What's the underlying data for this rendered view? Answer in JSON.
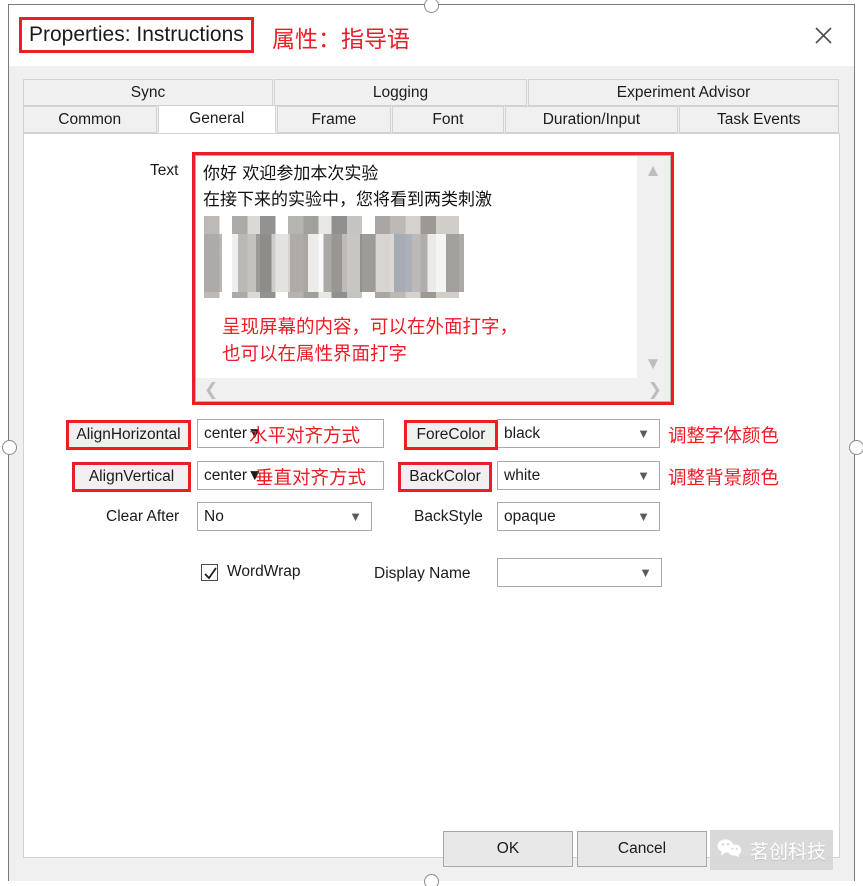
{
  "window": {
    "title": "Properties: Instructions",
    "title_annotation": "属性：指导语",
    "close_icon": "close-icon"
  },
  "tabs": {
    "row1": [
      {
        "label": "Sync",
        "active": false
      },
      {
        "label": "Logging",
        "active": false
      },
      {
        "label": "Experiment Advisor",
        "active": false
      }
    ],
    "row2": [
      {
        "label": "Common",
        "active": false
      },
      {
        "label": "General",
        "active": true
      },
      {
        "label": "Frame",
        "active": false
      },
      {
        "label": "Font",
        "active": false
      },
      {
        "label": "Duration/Input",
        "active": false
      },
      {
        "label": "Task Events",
        "active": false
      }
    ]
  },
  "form": {
    "text_field": {
      "label": "Text",
      "value": "你好 欢迎参加本次实验\n在接下来的实验中，您将看到两类刺激",
      "annotation": "呈现屏幕的内容，可以在外面打字，\n也可以在属性界面打字",
      "scroll_up_icon": "chevron-up-icon",
      "scroll_down_icon": "chevron-down-icon",
      "scroll_left_icon": "chevron-left-icon",
      "scroll_right_icon": "chevron-right-icon"
    },
    "align_horizontal": {
      "label": "AlignHorizontal",
      "value": "center",
      "annotation": "水平对齐方式"
    },
    "align_vertical": {
      "label": "AlignVertical",
      "value": "center",
      "annotation": "垂直对齐方式"
    },
    "fore_color": {
      "label": "ForeColor",
      "value": "black",
      "annotation": "调整字体颜色"
    },
    "back_color": {
      "label": "BackColor",
      "value": "white",
      "annotation": "调整背景颜色"
    },
    "clear_after": {
      "label": "Clear After",
      "value": "No"
    },
    "back_style": {
      "label": "BackStyle",
      "value": "opaque"
    },
    "word_wrap": {
      "label": "WordWrap",
      "checked": true
    },
    "display_name": {
      "label": "Display Name",
      "value": ""
    }
  },
  "footer": {
    "ok_label": "OK",
    "cancel_label": "Cancel",
    "watermark_text": "茗创科技",
    "watermark_icon": "wechat-icon"
  },
  "colors": {
    "annotation_red": "#ee1c24",
    "dialog_bg": "#f0f0f0",
    "field_bg": "#ffffff"
  }
}
